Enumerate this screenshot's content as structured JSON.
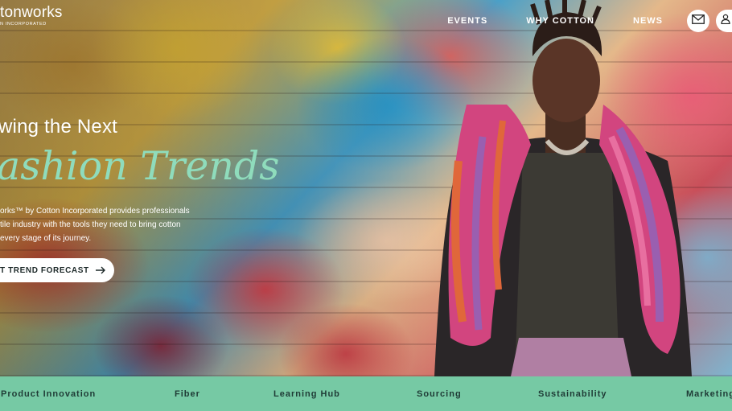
{
  "brand": {
    "logo_text": "tonworks",
    "logo_sub": "N INCORPORATED"
  },
  "nav": {
    "items": [
      "EVENTS",
      "WHY COTTON",
      "NEWS"
    ],
    "mail_icon": "mail-icon",
    "user_icon": "user-icon"
  },
  "hero": {
    "headline": "wing the Next",
    "headline_script": "ashion Trends",
    "blurb_lines": [
      "orks™ by Cotton Incorporated provides professionals",
      "tile industry with the tools they need to bring cotton",
      "every stage of its journey."
    ],
    "cta_label": "T TREND FORECAST",
    "cta_icon": "arrow-right-icon"
  },
  "categories": [
    "Product Innovation",
    "Fiber",
    "Learning Hub",
    "Sourcing",
    "Sustainability",
    "Marketing"
  ],
  "colors": {
    "accent_green": "#76c9a4",
    "script_green": "#8fdcbc",
    "dark_text": "#1f3b36"
  }
}
